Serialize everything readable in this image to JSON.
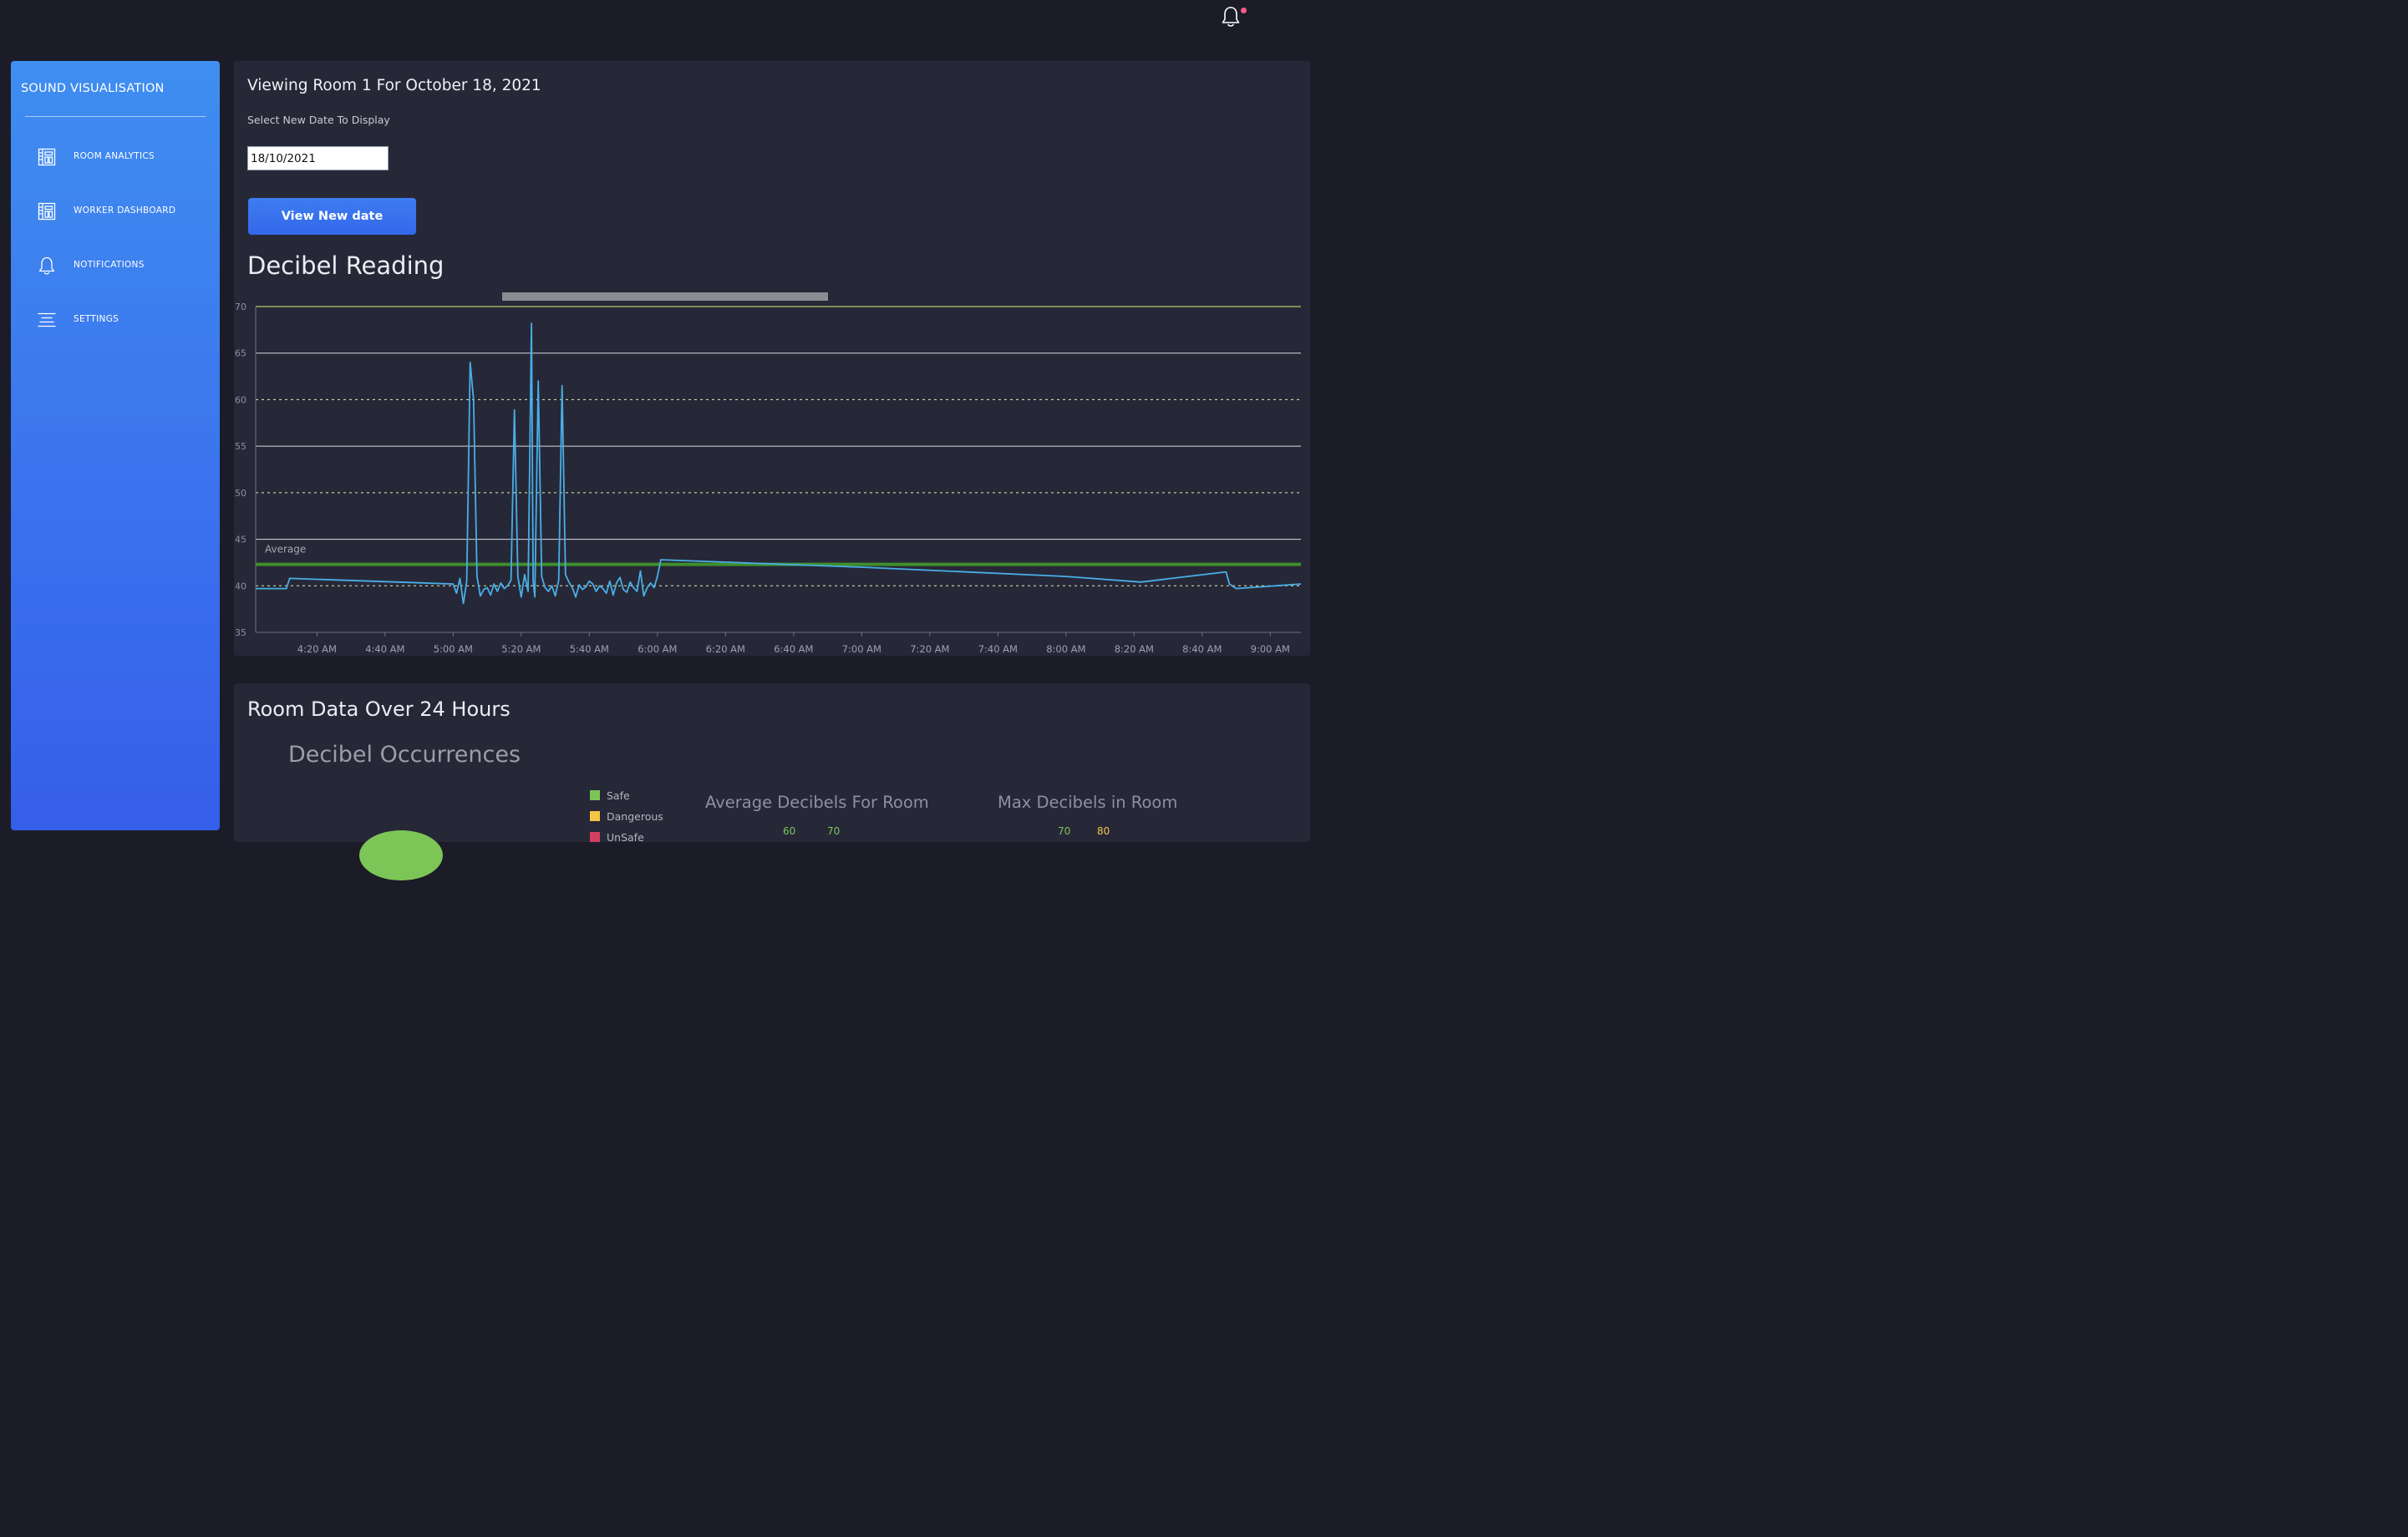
{
  "brand": {
    "title": "SOUND VISUALISATION"
  },
  "sidebar": {
    "items": [
      {
        "label": "ROOM ANALYTICS",
        "icon": "dashboard-layout-icon"
      },
      {
        "label": "WORKER DASHBOARD",
        "icon": "dashboard-layout-icon"
      },
      {
        "label": "NOTIFICATIONS",
        "icon": "bell-icon"
      },
      {
        "label": "SETTINGS",
        "icon": "settings-lines-icon"
      }
    ]
  },
  "header": {
    "notification_icon": "bell-icon",
    "has_unread": true,
    "badge_color": "#ff5a8c"
  },
  "main": {
    "title": "Viewing Room 1 For October 18, 2021",
    "date_caption": "Select New Date To Display",
    "date_value": "18/10/2021",
    "view_button_label": "View New date",
    "chart_heading": "Decibel Reading"
  },
  "chart_data": {
    "type": "line",
    "title": "Decibel Reading",
    "xlabel": "",
    "ylabel": "",
    "ylim": [
      35,
      70
    ],
    "yticks": [
      35,
      40,
      45,
      50,
      55,
      60,
      65,
      70
    ],
    "xlim": [
      "04:02",
      "09:09"
    ],
    "xticks": [
      "4:20 AM",
      "4:40 AM",
      "5:00 AM",
      "5:20 AM",
      "5:40 AM",
      "6:00 AM",
      "6:20 AM",
      "6:40 AM",
      "7:00 AM",
      "7:20 AM",
      "7:40 AM",
      "8:00 AM",
      "8:20 AM",
      "8:40 AM",
      "9:00 AM"
    ],
    "grid": true,
    "reference_lines": [
      {
        "value": 70,
        "color": "#d9ee6a",
        "style": "solid"
      },
      {
        "value": 65,
        "color": "#d8d9e0",
        "style": "solid"
      },
      {
        "value": 60,
        "color": "#e6f2a8",
        "style": "dashed"
      },
      {
        "value": 55,
        "color": "#d8d9e0",
        "style": "solid"
      },
      {
        "value": 50,
        "color": "#e6f2a8",
        "style": "dashed"
      },
      {
        "value": 45,
        "color": "#d8d9e0",
        "style": "solid"
      },
      {
        "value": 40,
        "color": "#e6f2a8",
        "style": "dashed"
      }
    ],
    "average": {
      "label": "Average",
      "value": 42.3,
      "color": "#3f8f2c"
    },
    "series": [
      {
        "color": "#4aaee6",
        "points": [
          [
            "04:02",
            39.7
          ],
          [
            "04:11",
            39.7
          ],
          [
            "04:12",
            40.8
          ],
          [
            "05:00",
            40.2
          ],
          [
            "05:01",
            39.2
          ],
          [
            "05:02",
            40.8
          ],
          [
            "05:03",
            38.1
          ],
          [
            "05:04",
            40.5
          ],
          [
            "05:05",
            64.0
          ],
          [
            "05:06",
            60.0
          ],
          [
            "05:07",
            41.0
          ],
          [
            "05:08",
            38.9
          ],
          [
            "05:09",
            39.6
          ],
          [
            "05:10",
            39.8
          ],
          [
            "05:11",
            39.0
          ],
          [
            "05:12",
            40.2
          ],
          [
            "05:13",
            39.4
          ],
          [
            "05:14",
            40.3
          ],
          [
            "05:15",
            39.7
          ],
          [
            "05:16",
            40.0
          ],
          [
            "05:17",
            40.6
          ],
          [
            "05:18",
            58.9
          ],
          [
            "05:19",
            41.0
          ],
          [
            "05:20",
            38.8
          ],
          [
            "05:21",
            41.2
          ],
          [
            "05:22",
            39.4
          ],
          [
            "05:23",
            68.2
          ],
          [
            "05:23.5",
            40.5
          ],
          [
            "05:24",
            38.8
          ],
          [
            "05:25",
            62.0
          ],
          [
            "05:26",
            41.0
          ],
          [
            "05:27",
            39.8
          ],
          [
            "05:28",
            39.4
          ],
          [
            "05:29",
            40.0
          ],
          [
            "05:30",
            38.9
          ],
          [
            "05:31",
            40.6
          ],
          [
            "05:32",
            61.5
          ],
          [
            "05:33",
            41.2
          ],
          [
            "05:34",
            40.4
          ],
          [
            "05:35",
            39.8
          ],
          [
            "05:36",
            38.8
          ],
          [
            "05:37",
            40.1
          ],
          [
            "05:38",
            39.6
          ],
          [
            "05:39",
            39.9
          ],
          [
            "05:40",
            40.5
          ],
          [
            "05:41",
            40.2
          ],
          [
            "05:42",
            39.4
          ],
          [
            "05:43",
            40.0
          ],
          [
            "05:44",
            39.7
          ],
          [
            "05:45",
            39.2
          ],
          [
            "05:46",
            40.5
          ],
          [
            "05:47",
            39.0
          ],
          [
            "05:48",
            40.3
          ],
          [
            "05:49",
            40.9
          ],
          [
            "05:50",
            39.6
          ],
          [
            "05:51",
            39.3
          ],
          [
            "05:52",
            40.4
          ],
          [
            "05:53",
            39.8
          ],
          [
            "05:54",
            39.4
          ],
          [
            "05:55",
            41.6
          ],
          [
            "05:56",
            38.9
          ],
          [
            "05:57",
            39.8
          ],
          [
            "05:58",
            40.3
          ],
          [
            "05:59",
            39.8
          ],
          [
            "06:00",
            41.0
          ],
          [
            "06:01",
            42.8
          ],
          [
            "07:00",
            42.0
          ],
          [
            "08:00",
            41.0
          ],
          [
            "08:22",
            40.4
          ],
          [
            "08:47",
            41.5
          ],
          [
            "08:48",
            40.2
          ],
          [
            "08:50",
            39.7
          ],
          [
            "09:09",
            40.2
          ]
        ]
      }
    ]
  },
  "room_data": {
    "title": "Room Data Over 24 Hours",
    "occurrences_title": "Decibel Occurrences",
    "legend": [
      {
        "label": "Safe",
        "color": "#7cc557"
      },
      {
        "label": "Dangerous",
        "color": "#f6c544"
      },
      {
        "label": "UnSafe",
        "color": "#d33f62"
      }
    ],
    "avg_title": "Average Decibels For Room",
    "avg_ticks": [
      "60",
      "70"
    ],
    "max_title": "Max Decibels in Room",
    "max_ticks": [
      "70",
      "80"
    ],
    "colors": {
      "green": "#7cc557",
      "yellow": "#f6c544"
    }
  }
}
